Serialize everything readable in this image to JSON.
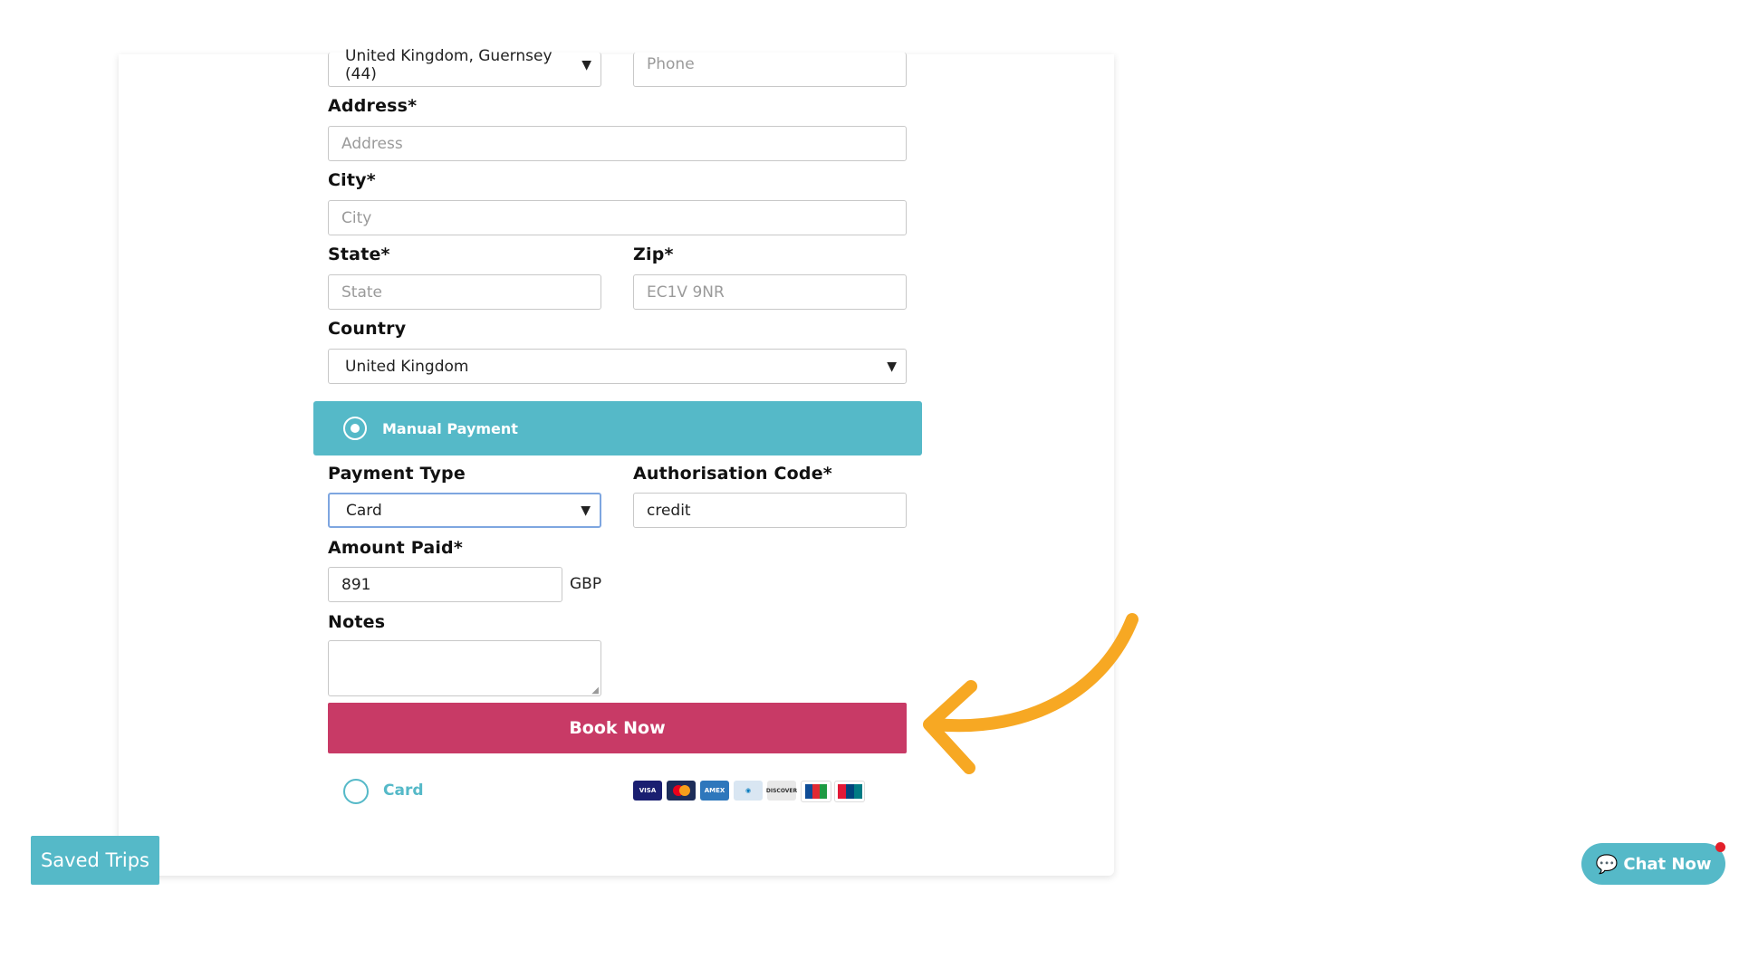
{
  "form": {
    "phone_country_value": "United Kingdom, Guernsey (44)",
    "phone_placeholder": "Phone",
    "address_label": "Address*",
    "address_placeholder": "Address",
    "city_label": "City*",
    "city_placeholder": "City",
    "state_label": "State*",
    "state_placeholder": "State",
    "zip_label": "Zip*",
    "zip_placeholder": "EC1V 9NR",
    "country_label": "Country",
    "country_value": "United Kingdom"
  },
  "payment": {
    "manual_label": "Manual Payment",
    "type_label": "Payment Type",
    "type_value": "Card",
    "auth_label": "Authorisation Code*",
    "auth_value": "credit",
    "amount_label": "Amount Paid*",
    "amount_value": "891",
    "currency": "GBP",
    "notes_label": "Notes",
    "book_label": "Book Now",
    "card_option_label": "Card",
    "card_brands": [
      "VISA",
      "MC",
      "AMEX",
      "DINERS",
      "DISCOVER",
      "JCB",
      "UNIONPAY"
    ]
  },
  "widgets": {
    "saved_trips_label": "Saved Trips",
    "chat_label": "Chat Now"
  },
  "colors": {
    "accent_teal": "#55b9c8",
    "book_button": "#c83a66",
    "arrow": "#f7a823",
    "notification": "#e3202a"
  }
}
